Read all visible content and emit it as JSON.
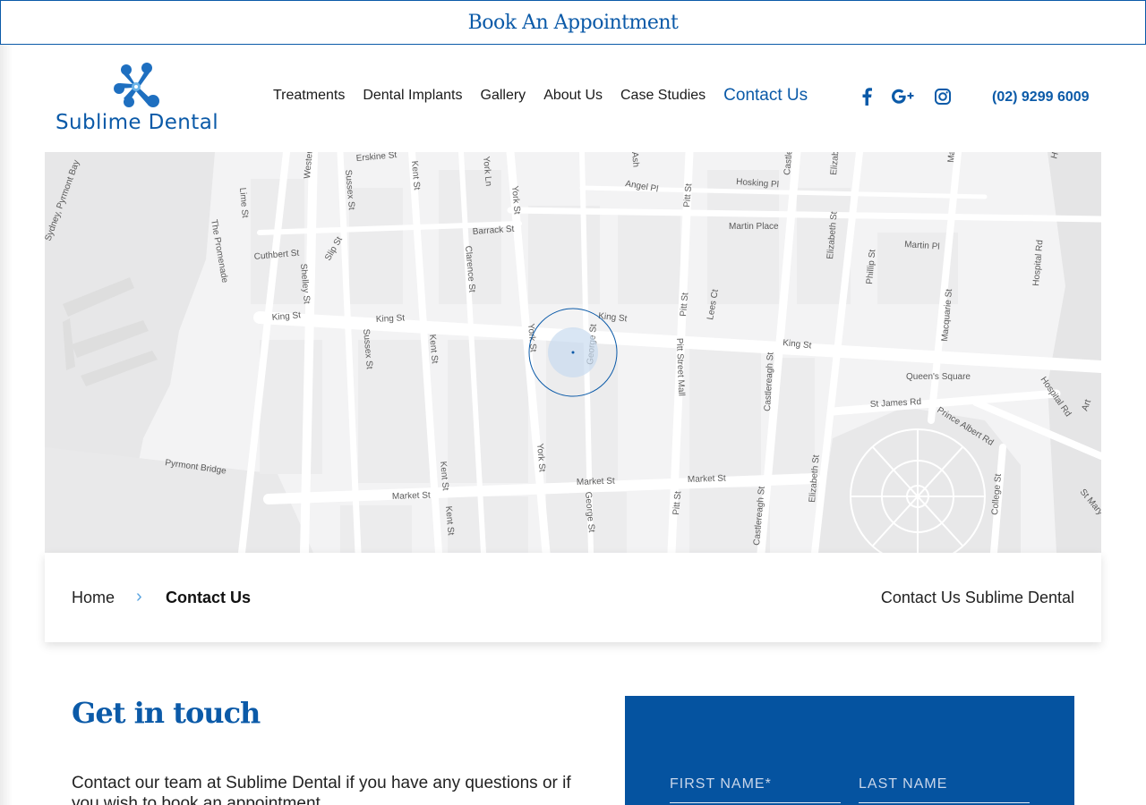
{
  "topbar": {
    "cta": "Book An Appointment"
  },
  "brand": {
    "name": "Sublime Dental",
    "color": "#0b5aa8"
  },
  "nav": {
    "items": [
      {
        "label": "Treatments",
        "active": false
      },
      {
        "label": "Dental Implants",
        "active": false
      },
      {
        "label": "Gallery",
        "active": false
      },
      {
        "label": "About Us",
        "active": false
      },
      {
        "label": "Case Studies",
        "active": false
      },
      {
        "label": "Contact Us",
        "active": true
      }
    ]
  },
  "socials": [
    "facebook-icon",
    "google-plus-icon",
    "instagram-icon"
  ],
  "phone": "(02) 9299 6009",
  "map": {
    "labels": {
      "erskine": "Erskine St",
      "west": "Western",
      "sussex1": "Sussex St",
      "kent1": "Kent St",
      "yorkln": "York Ln",
      "york1": "York St",
      "angel": "Angel Pl",
      "pitt1": "Pitt St",
      "hosking": "Hosking Pl",
      "castle": "Castlereagh St",
      "eliz1": "Elizabeth St",
      "lime": "Lime St",
      "shelley": "Shelley St",
      "cuthbert": "Cuthbert St",
      "slip": "Slip St",
      "barrack": "Barrack St",
      "clarence": "Clarence St",
      "martinplace": "Martin Place",
      "martinpl": "Martin Pl",
      "phillip": "Phillip St",
      "macquarie": "Macquarie St",
      "hospital1": "Hospital Rd",
      "promenade": "The Promenade",
      "sydney": "Sydney, Pyrmont Bay",
      "king1": "King St",
      "king2": "King St",
      "king3": "King St",
      "king4": "King St",
      "sussex2": "Sussex St",
      "kent2": "Kent St",
      "york2": "York St",
      "george1": "George St",
      "pitt2": "Pitt St",
      "lees": "Lees Ct",
      "pittmall": "Pitt Street Mall",
      "castle2": "Castlereagh St",
      "queens": "Queen's Square",
      "stjames": "St James Rd",
      "princealbert": "Prince Albert Rd",
      "hospital2": "Hospital Rd",
      "art": "Art",
      "pyrmont": "Pyrmont Bridge",
      "kent3": "Kent St",
      "york3": "York St",
      "market1": "Market St",
      "market2": "Market St",
      "market3": "Market St",
      "kent4": "Kent St",
      "george2": "George St",
      "pitt3": "Pitt St",
      "castle3": "Castlereagh St",
      "eliz2": "Elizabeth St",
      "college": "College St",
      "stmary": "St Mary",
      "ma": "Ma",
      "ho": "Ho",
      "ash": "Ash"
    }
  },
  "breadcrumb": {
    "home": "Home",
    "current": "Contact Us",
    "page_title": "Contact Us Sublime Dental"
  },
  "contact": {
    "title": "Get in touch",
    "text": "Contact our team at Sublime Dental if you have any questions or if you wish to book an appointment."
  },
  "form": {
    "first_name_placeholder": "FIRST NAME*",
    "last_name_placeholder": "LAST NAME",
    "bg": "#0553a0"
  }
}
